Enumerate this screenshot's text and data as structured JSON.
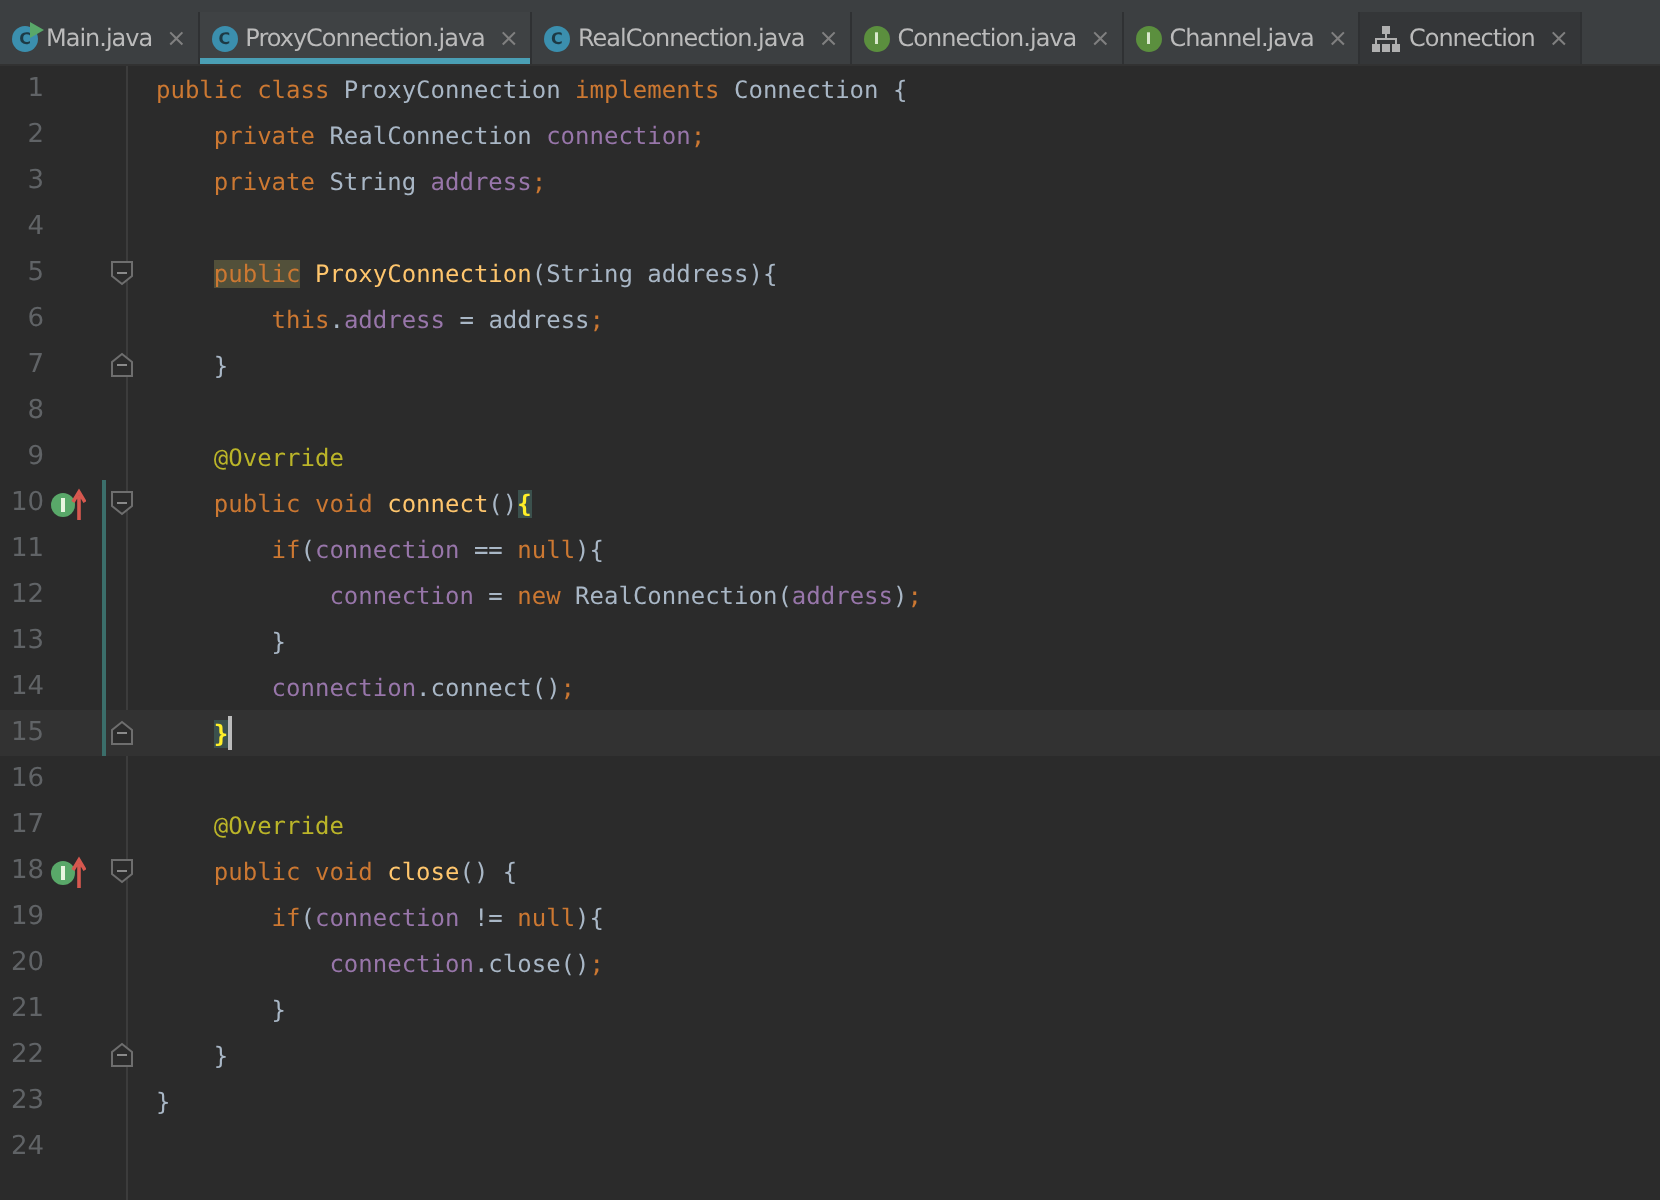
{
  "tabs": [
    {
      "label": "Main.java",
      "icon": "C",
      "kind": "class-run",
      "close": "×",
      "selected": false
    },
    {
      "label": "ProxyConnection.java",
      "icon": "C",
      "kind": "class",
      "close": "×",
      "selected": true
    },
    {
      "label": "RealConnection.java",
      "icon": "C",
      "kind": "class",
      "close": "×",
      "selected": false
    },
    {
      "label": "Connection.java",
      "icon": "I",
      "kind": "interface",
      "close": "×",
      "selected": false
    },
    {
      "label": "Channel.java",
      "icon": "I",
      "kind": "interface",
      "close": "×",
      "selected": false
    },
    {
      "label": "Connection",
      "kind": "diagram",
      "close": "×",
      "selected": false
    }
  ],
  "editor": {
    "lines": [
      {
        "number": "1",
        "current": false,
        "changed": false,
        "tokens": [
          {
            "text": "public class ",
            "kind": "keyword"
          },
          {
            "text": "ProxyConnection ",
            "kind": "plain"
          },
          {
            "text": "implements ",
            "kind": "keyword"
          },
          {
            "text": "Connection {",
            "kind": "plain"
          }
        ]
      },
      {
        "number": "2",
        "current": false,
        "changed": false,
        "tokens": [
          {
            "text": "    private ",
            "kind": "keyword"
          },
          {
            "text": "RealConnection ",
            "kind": "plain"
          },
          {
            "text": "connection",
            "kind": "field"
          },
          {
            "text": ";",
            "kind": "keyword"
          }
        ]
      },
      {
        "number": "3",
        "current": false,
        "changed": false,
        "tokens": [
          {
            "text": "    private ",
            "kind": "keyword"
          },
          {
            "text": "String ",
            "kind": "plain"
          },
          {
            "text": "address",
            "kind": "field"
          },
          {
            "text": ";",
            "kind": "keyword"
          }
        ]
      },
      {
        "number": "4",
        "current": false,
        "changed": false
      },
      {
        "number": "5",
        "current": false,
        "changed": false,
        "fold": {
          "kind": "start"
        },
        "tokens": [
          {
            "text": "    public",
            "kind": "keyword",
            "highlight": {
              "kind": "usage"
            }
          },
          {
            "text": " ProxyConnection",
            "kind": "method"
          },
          {
            "text": "(String address){",
            "kind": "plain"
          }
        ]
      },
      {
        "number": "6",
        "current": false,
        "changed": false,
        "tokens": [
          {
            "text": "        this",
            "kind": "keyword"
          },
          {
            "text": ".",
            "kind": "plain"
          },
          {
            "text": "address",
            "kind": "field"
          },
          {
            "text": " = address",
            "kind": "plain"
          },
          {
            "text": ";",
            "kind": "keyword"
          }
        ]
      },
      {
        "number": "7",
        "current": false,
        "changed": false,
        "fold": {
          "kind": "end"
        },
        "tokens": [
          {
            "text": "    }",
            "kind": "plain"
          }
        ]
      },
      {
        "number": "8",
        "current": false,
        "changed": false
      },
      {
        "number": "9",
        "current": false,
        "changed": false,
        "tokens": [
          {
            "text": "    @Override",
            "kind": "annotation"
          }
        ]
      },
      {
        "number": "10",
        "current": false,
        "changed": true,
        "fold": {
          "kind": "start"
        },
        "marker": {
          "kind": "implements"
        },
        "tokens": [
          {
            "text": "    public void ",
            "kind": "keyword"
          },
          {
            "text": "connect",
            "kind": "method"
          },
          {
            "text": "()",
            "kind": "plain"
          },
          {
            "text": "{",
            "kind": "plain",
            "highlight": {
              "kind": "brace"
            }
          }
        ]
      },
      {
        "number": "11",
        "current": false,
        "changed": true,
        "tokens": [
          {
            "text": "        if",
            "kind": "keyword"
          },
          {
            "text": "(",
            "kind": "plain"
          },
          {
            "text": "connection",
            "kind": "field"
          },
          {
            "text": " == ",
            "kind": "plain"
          },
          {
            "text": "null",
            "kind": "keyword"
          },
          {
            "text": "){",
            "kind": "plain"
          }
        ]
      },
      {
        "number": "12",
        "current": false,
        "changed": true,
        "tokens": [
          {
            "text": "            connection",
            "kind": "field"
          },
          {
            "text": " = ",
            "kind": "plain"
          },
          {
            "text": "new ",
            "kind": "keyword"
          },
          {
            "text": "RealConnection(",
            "kind": "plain"
          },
          {
            "text": "address",
            "kind": "field"
          },
          {
            "text": ")",
            "kind": "plain"
          },
          {
            "text": ";",
            "kind": "keyword"
          }
        ]
      },
      {
        "number": "13",
        "current": false,
        "changed": true,
        "tokens": [
          {
            "text": "        }",
            "kind": "plain"
          }
        ]
      },
      {
        "number": "14",
        "current": false,
        "changed": true,
        "tokens": [
          {
            "text": "        connection",
            "kind": "field"
          },
          {
            "text": ".connect()",
            "kind": "plain"
          },
          {
            "text": ";",
            "kind": "keyword"
          }
        ]
      },
      {
        "number": "15",
        "current": true,
        "changed": true,
        "fold": {
          "kind": "end"
        },
        "tokens": [
          {
            "text": "    }",
            "kind": "plain",
            "highlight": {
              "kind": "brace"
            }
          }
        ]
      },
      {
        "number": "16",
        "current": false,
        "changed": false
      },
      {
        "number": "17",
        "current": false,
        "changed": false,
        "tokens": [
          {
            "text": "    @Override",
            "kind": "annotation"
          }
        ]
      },
      {
        "number": "18",
        "current": false,
        "changed": false,
        "fold": {
          "kind": "start"
        },
        "marker": {
          "kind": "implements"
        },
        "tokens": [
          {
            "text": "    public void ",
            "kind": "keyword"
          },
          {
            "text": "close",
            "kind": "method"
          },
          {
            "text": "() {",
            "kind": "plain"
          }
        ]
      },
      {
        "number": "19",
        "current": false,
        "changed": false,
        "tokens": [
          {
            "text": "        if",
            "kind": "keyword"
          },
          {
            "text": "(",
            "kind": "plain"
          },
          {
            "text": "connection",
            "kind": "field"
          },
          {
            "text": " != ",
            "kind": "plain"
          },
          {
            "text": "null",
            "kind": "keyword"
          },
          {
            "text": "){",
            "kind": "plain"
          }
        ]
      },
      {
        "number": "20",
        "current": false,
        "changed": false,
        "tokens": [
          {
            "text": "            connection",
            "kind": "field"
          },
          {
            "text": ".close()",
            "kind": "plain"
          },
          {
            "text": ";",
            "kind": "keyword"
          }
        ]
      },
      {
        "number": "21",
        "current": false,
        "changed": false,
        "tokens": [
          {
            "text": "        }",
            "kind": "plain"
          }
        ]
      },
      {
        "number": "22",
        "current": false,
        "changed": false,
        "fold": {
          "kind": "end"
        },
        "tokens": [
          {
            "text": "    }",
            "kind": "plain"
          }
        ]
      },
      {
        "number": "23",
        "current": false,
        "changed": false,
        "tokens": [
          {
            "text": "}",
            "kind": "plain"
          }
        ]
      },
      {
        "number": "24",
        "current": false,
        "changed": false
      }
    ]
  }
}
